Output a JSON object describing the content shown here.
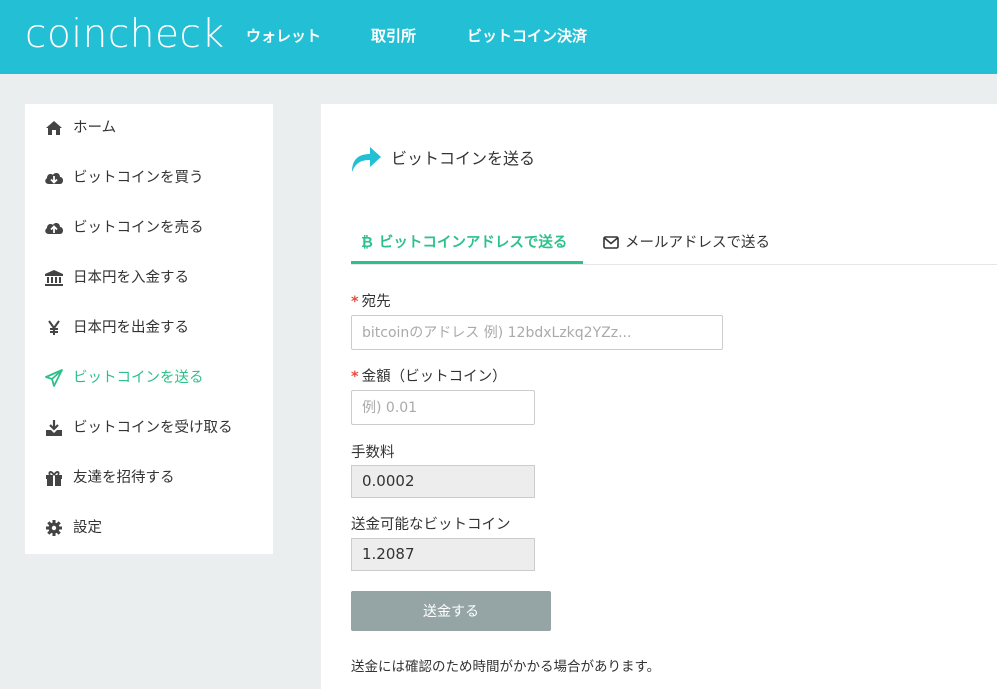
{
  "header": {
    "logo": "coincheck",
    "nav": [
      "ウォレット",
      "取引所",
      "ビットコイン決済"
    ],
    "bg_color": "#23bfd4"
  },
  "sidebar": {
    "items": [
      {
        "label": "ホーム",
        "icon": "home-icon"
      },
      {
        "label": "ビットコインを買う",
        "icon": "cloud-download-icon"
      },
      {
        "label": "ビットコインを売る",
        "icon": "cloud-upload-icon"
      },
      {
        "label": "日本円を入金する",
        "icon": "bank-icon"
      },
      {
        "label": "日本円を出金する",
        "icon": "yen-icon"
      },
      {
        "label": "ビットコインを送る",
        "icon": "paper-plane-icon",
        "active": true
      },
      {
        "label": "ビットコインを受け取る",
        "icon": "download-icon"
      },
      {
        "label": "友達を招待する",
        "icon": "gift-icon"
      },
      {
        "label": "設定",
        "icon": "gear-icon"
      }
    ],
    "active_color": "#2cc18b"
  },
  "main": {
    "title": "ビットコインを送る",
    "tabs": [
      {
        "label": "ビットコインアドレスで送る",
        "icon": "bitcoin-icon",
        "active": true
      },
      {
        "label": "メールアドレスで送る",
        "icon": "envelope-icon",
        "active": false
      }
    ],
    "form": {
      "required_mark": "*",
      "address_label": "宛先",
      "address_placeholder": "bitcoinのアドレス 例) 12bdxLzkq2YZz...",
      "amount_label": "金額（ビットコイン）",
      "amount_placeholder": "例) 0.01",
      "fee_label": "手数料",
      "fee_value": "0.0002",
      "available_label": "送金可能なビットコイン",
      "available_value": "1.2087",
      "submit_label": "送金する",
      "note": "送金には確認のため時間がかかる場合があります。"
    }
  }
}
